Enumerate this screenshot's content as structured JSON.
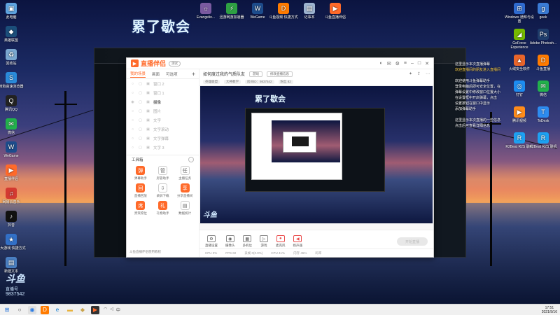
{
  "overlay_title": "累了歇会",
  "desktop_left": [
    {
      "label": "此电脑",
      "glyph": "▣",
      "color": "#5ea4e0"
    },
    {
      "label": "英雄联盟",
      "glyph": "◆",
      "color": "#1b4e7a"
    },
    {
      "label": "回收站",
      "glyph": "♻",
      "color": "#7aa7cf"
    },
    {
      "label": "搜狗高速浏览器",
      "glyph": "S",
      "color": "#2a8ad9"
    },
    {
      "label": "腾讯QQ",
      "glyph": "Q",
      "color": "#222"
    },
    {
      "label": "微信",
      "glyph": "✉",
      "color": "#22b14c"
    },
    {
      "label": "WeGame",
      "glyph": "W",
      "color": "#1d4c8c"
    },
    {
      "label": "直播伴侣",
      "glyph": "▶",
      "color": "#ff6a2a"
    },
    {
      "label": "网易云音乐",
      "glyph": "♫",
      "color": "#d33a31"
    },
    {
      "label": "抖音",
      "glyph": "♪",
      "color": "#111"
    },
    {
      "label": "盛大游戏 快捷方式",
      "glyph": "★",
      "color": "#3270c7"
    },
    {
      "label": "新建文本",
      "glyph": "▤",
      "color": "#4a7fc1"
    }
  ],
  "desktop_top": [
    {
      "label": "Evangelio...",
      "glyph": "☼",
      "color": "#7a5aa0"
    },
    {
      "label": "迅游网游加速器",
      "glyph": "⚡",
      "color": "#2ea043"
    },
    {
      "label": "WeGame",
      "glyph": "W",
      "color": "#1d4c8c"
    },
    {
      "label": "斗鱼视频 快捷方式",
      "glyph": "D",
      "color": "#ff7b00"
    },
    {
      "label": "记事本",
      "glyph": "▤",
      "color": "#9cb3cf"
    },
    {
      "label": "斗鱼直播伴侣",
      "glyph": "▶",
      "color": "#ff6a2a"
    }
  ],
  "desktop_right": [
    {
      "label": "Windows 通知与设置",
      "glyph": "⊞",
      "color": "#2f6bd0"
    },
    {
      "label": "geek",
      "glyph": "g",
      "color": "#3a7bd5"
    },
    {
      "label": "GeForce Experience",
      "glyph": "◢",
      "color": "#76b900"
    },
    {
      "label": "Adobe Photosh...",
      "glyph": "Ps",
      "color": "#1f3d6c"
    },
    {
      "label": "火绒安全软件",
      "glyph": "▲",
      "color": "#e9652a"
    },
    {
      "label": "斗鱼直播",
      "glyph": "D",
      "color": "#ff7b00"
    },
    {
      "label": "钉钉",
      "glyph": "◎",
      "color": "#1d8cf0"
    },
    {
      "label": "微信",
      "glyph": "✉",
      "color": "#22b14c"
    },
    {
      "label": "腾讯视频",
      "glyph": "▶",
      "color": "#ff8c1a"
    },
    {
      "label": "ToDesk",
      "glyph": "T",
      "color": "#2d8cf0"
    },
    {
      "label": "R2Beat R2S 联机",
      "glyph": "R",
      "color": "#1da1f2"
    },
    {
      "label": "R2Beat R2S 联机",
      "glyph": "R",
      "color": "#1da1f2"
    }
  ],
  "logo_left": {
    "brand": "斗鱼",
    "caption": "直播号",
    "room": "9837542"
  },
  "window": {
    "title": "直播伴侣",
    "version": "测试",
    "tabs": [
      "我的场景",
      "画面",
      "可选项"
    ],
    "scenes": [
      {
        "name": "窗口 2",
        "on": false
      },
      {
        "name": "窗口 1",
        "on": false
      },
      {
        "name": "摄像",
        "on": true
      },
      {
        "name": "图片",
        "on": false
      },
      {
        "name": "文字",
        "on": false
      },
      {
        "name": "文字滚动",
        "on": false
      },
      {
        "name": "文字弹幕",
        "on": false
      },
      {
        "name": "文字 3",
        "on": false
      }
    ],
    "tools_title": "工具箱",
    "tools": [
      {
        "label": "弹幕助手",
        "glyph": "弹",
        "hot": true
      },
      {
        "label": "房管助手",
        "glyph": "管",
        "hot": false
      },
      {
        "label": "主播任务",
        "glyph": "任",
        "hot": false
      },
      {
        "label": "直播回放",
        "glyph": "回",
        "hot": true
      },
      {
        "label": "录屏下载",
        "glyph": "⇩",
        "hot": false
      },
      {
        "label": "分享直播间",
        "glyph": "享",
        "hot": true
      },
      {
        "label": "贵宾席位",
        "glyph": "席",
        "hot": true
      },
      {
        "label": "礼物助手",
        "glyph": "礼",
        "hot": true
      },
      {
        "label": "数据统计",
        "glyph": "▤",
        "hot": false
      }
    ],
    "promo": "斗鱼直播伴侣使用教程",
    "room_title": "如何度过我的气质队友",
    "cat_pill": "游戏",
    "info_button": "修改直播信息",
    "sub_chips": [
      "英雄联盟",
      "大神教学",
      "房间ID：9837542",
      "粉丝 82"
    ],
    "preview_title": "累了歇会",
    "preview_logo": "斗鱼",
    "controls": [
      {
        "label": "直播设置",
        "glyph": "⚙",
        "red": false
      },
      {
        "label": "摄像头",
        "glyph": "◉",
        "red": false
      },
      {
        "label": "多机位",
        "glyph": "▦",
        "red": false
      },
      {
        "label": "游戏",
        "glyph": "▷",
        "red": false
      },
      {
        "label": "麦克风",
        "glyph": "●",
        "red": true
      },
      {
        "label": "扬声器",
        "glyph": "◀",
        "red": true
      }
    ],
    "golive": "开始直播",
    "status": [
      "CPU 0%",
      "FPS 60",
      "丢帧 0(0.0%)",
      "CPU 41%",
      "内存 45%",
      "码率"
    ]
  },
  "chat_lines": [
    {
      "text": "这里显示本次直播弹幕",
      "hl": false
    },
    {
      "text": "欢迎直播间的朋友进入直播间",
      "hl": true
    },
    {
      "text": "",
      "hl": false
    },
    {
      "text": "欢迎使用斗鱼弹幕助手",
      "hl": false
    },
    {
      "text": "登录电脑后即可安全位置，在",
      "hl": false
    },
    {
      "text": "弹幕设置中修改窗口位置大小",
      "hl": false
    },
    {
      "text": "在设置框中开启弹幕，点击",
      "hl": false
    },
    {
      "text": "设置按钮在窗口中显示",
      "hl": false
    },
    {
      "text": "添加弹幕助手",
      "hl": false
    },
    {
      "text": "",
      "hl": false
    },
    {
      "text": "这里显示本次直播的一些信息",
      "hl": false
    },
    {
      "text": "点击后可查看详细信息",
      "hl": false
    }
  ],
  "taskbar": {
    "time": "17:51",
    "date": "2021/9/16"
  },
  "colors": {
    "accent": "#ff6a2a"
  }
}
